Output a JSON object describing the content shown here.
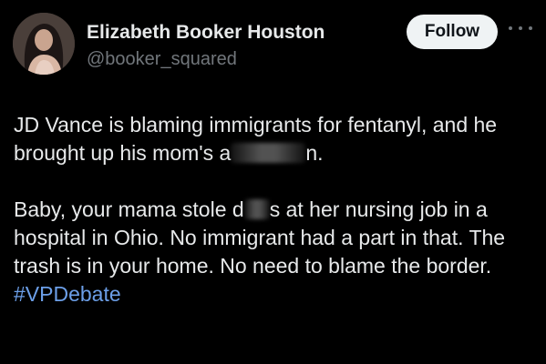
{
  "author": {
    "display_name": "Elizabeth Booker Houston",
    "handle": "@booker_squared",
    "avatar_icon": "user-avatar"
  },
  "actions": {
    "follow_label": "Follow",
    "more_icon": "more-options-icon"
  },
  "tweet": {
    "p1_a": "JD Vance is blaming immigrants for fentanyl, and he brought up his mom's a",
    "p1_b": "n.",
    "p2_a": "Baby, your mama stole d",
    "p2_b": "s at her nursing job in a hospital in Ohio. No immigrant had a part in that. The trash is in your home. No need to blame the border. ",
    "hashtag": "#VPDebate"
  },
  "colors": {
    "background": "#000000",
    "text": "#e7e9ea",
    "secondary": "#71767b",
    "link": "#6c9fe8",
    "button_bg": "#eff3f4"
  }
}
